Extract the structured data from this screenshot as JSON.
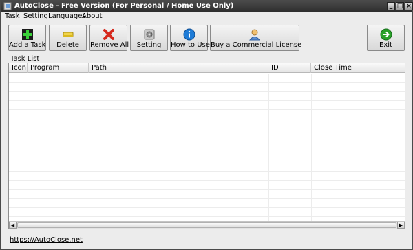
{
  "window": {
    "title": "AutoClose - Free Version (For Personal / Home Use Only)",
    "icon": "app-icon"
  },
  "menu": [
    "Task",
    "Setting",
    "Languages",
    "About"
  ],
  "toolbar": {
    "add": "Add a Task",
    "delete": "Delete",
    "remove_all": "Remove All",
    "setting": "Setting",
    "how_to_use": "How to Use",
    "buy": "Buy a Commercial License",
    "exit": "Exit"
  },
  "task_list": {
    "label": "Task List",
    "columns": [
      "Icon",
      "Program",
      "Path",
      "ID",
      "Close Time"
    ],
    "rows": []
  },
  "footer": {
    "link": "https://AutoClose.net"
  },
  "colors": {
    "titlebar": "#2e2e2e",
    "accent_green": "#2aa12a",
    "accent_blue": "#1e7bd6",
    "accent_red": "#d62a1e"
  }
}
